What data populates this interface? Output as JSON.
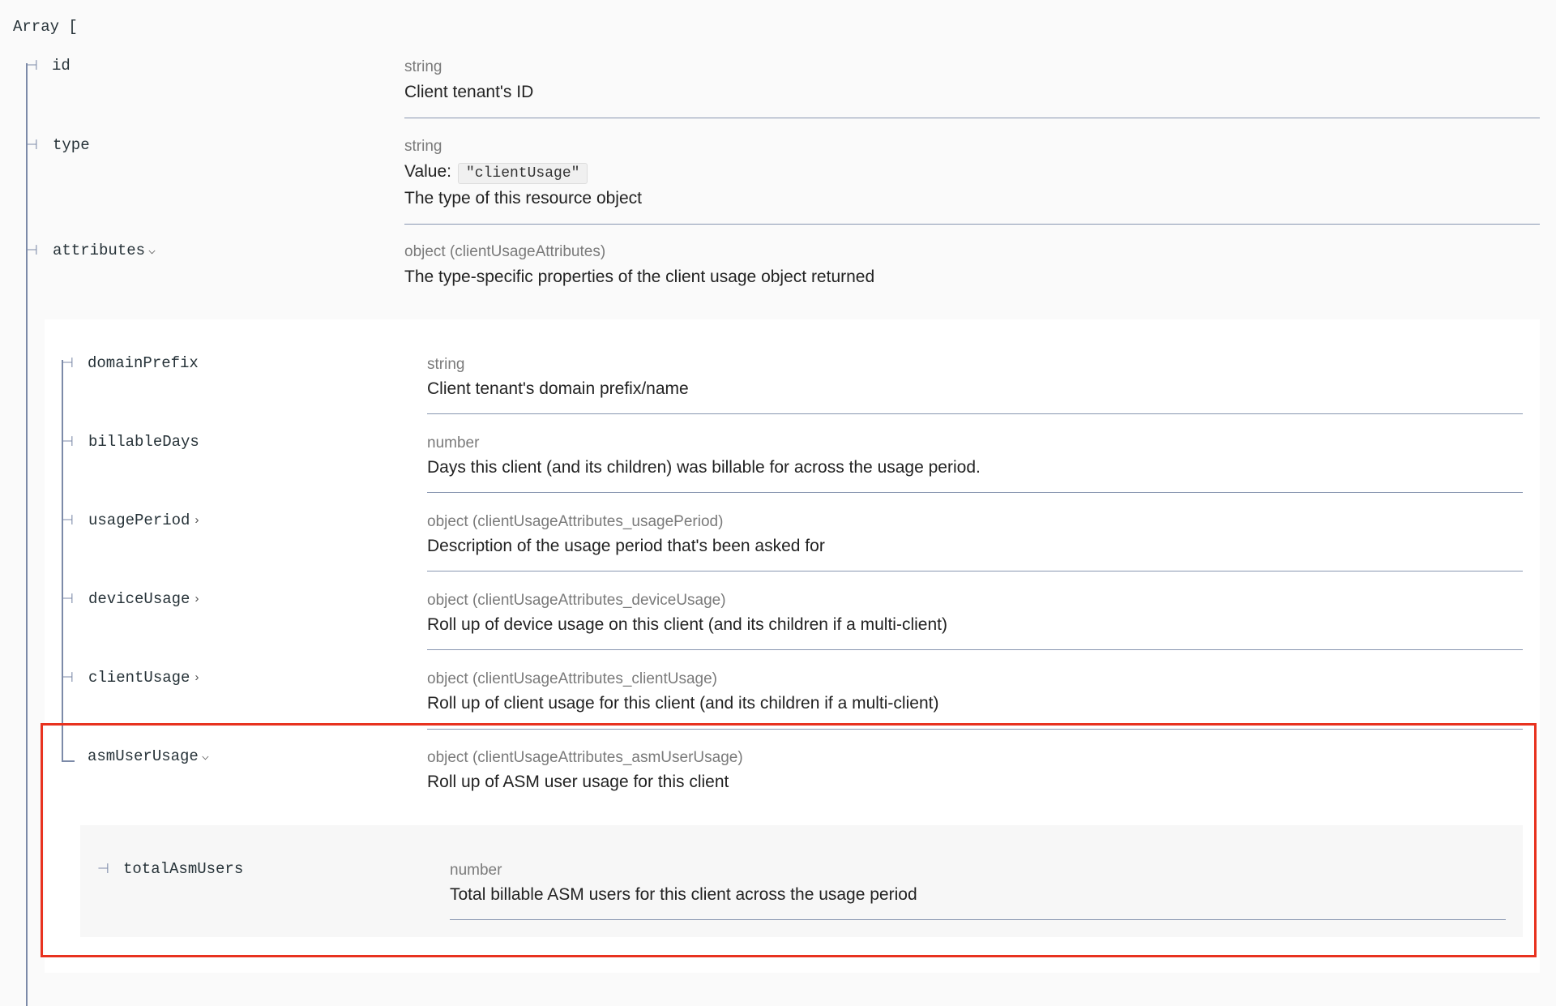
{
  "array_open": "Array [",
  "colors": {
    "tree_line": "#7c8aa8",
    "divider": "#8896b0",
    "highlight": "#e8321f",
    "nested_bg": "#ffffff",
    "nested2_bg": "#f7f7f7"
  },
  "properties": [
    {
      "name": "id",
      "type": "string",
      "description": "Client tenant's ID"
    },
    {
      "name": "type",
      "type": "string",
      "value_label": "Value:",
      "value": "\"clientUsage\"",
      "description": "The type of this resource object"
    },
    {
      "name": "attributes",
      "type": "object (clientUsageAttributes)",
      "description": "The type-specific properties of the client usage object returned",
      "expanded": true,
      "chevron_icon": "chevron-down-icon"
    }
  ],
  "attributes": [
    {
      "name": "domainPrefix",
      "type": "string",
      "description": "Client tenant's domain prefix/name"
    },
    {
      "name": "billableDays",
      "type": "number",
      "description": "Days this client (and its children) was billable for across the usage period."
    },
    {
      "name": "usagePeriod",
      "type": "object (clientUsageAttributes_usagePeriod)",
      "description": "Description of the usage period that's been asked for",
      "chevron_icon": "chevron-right-icon"
    },
    {
      "name": "deviceUsage",
      "type": "object (clientUsageAttributes_deviceUsage)",
      "description": "Roll up of device usage on this client (and its children if a multi-client)",
      "chevron_icon": "chevron-right-icon"
    },
    {
      "name": "clientUsage",
      "type": "object (clientUsageAttributes_clientUsage)",
      "description": "Roll up of client usage for this client (and its children if a multi-client)",
      "chevron_icon": "chevron-right-icon"
    },
    {
      "name": "asmUserUsage",
      "type": "object (clientUsageAttributes_asmUserUsage)",
      "description": "Roll up of ASM user usage for this client",
      "expanded": true,
      "chevron_icon": "chevron-down-icon"
    }
  ],
  "asm_user_usage": [
    {
      "name": "totalAsmUsers",
      "type": "number",
      "description": "Total billable ASM users for this client across the usage period"
    }
  ]
}
